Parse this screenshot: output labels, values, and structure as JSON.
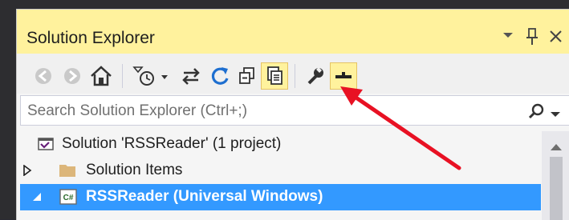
{
  "panel": {
    "title": "Solution Explorer",
    "title_controls": [
      "dropdown-arrow",
      "pin",
      "close"
    ]
  },
  "toolbar": {
    "buttons": [
      {
        "name": "back",
        "icon": "back-arrow-icon"
      },
      {
        "name": "forward",
        "icon": "forward-arrow-icon"
      },
      {
        "name": "home",
        "icon": "home-icon"
      },
      {
        "name": "pending-changes-filter",
        "icon": "clock-filter-icon"
      },
      {
        "name": "sync-with-active-document",
        "icon": "sync-icon"
      },
      {
        "name": "refresh",
        "icon": "refresh-icon"
      },
      {
        "name": "collapse-all",
        "icon": "collapse-all-icon"
      },
      {
        "name": "show-all-files",
        "icon": "show-all-files-icon",
        "highlighted": true
      },
      {
        "name": "properties",
        "icon": "wrench-icon"
      },
      {
        "name": "preview-selected-items",
        "icon": "preview-icon",
        "highlighted": true
      }
    ]
  },
  "search": {
    "placeholder": "Search Solution Explorer (Ctrl+;)"
  },
  "tree": {
    "items": [
      {
        "label": "Solution 'RSSReader' (1 project)",
        "icon": "solution-icon"
      },
      {
        "label": "Solution Items",
        "icon": "folder-icon",
        "expander": "collapsed"
      },
      {
        "label": "RSSReader (Universal Windows)",
        "icon": "csharp-project-icon",
        "expander": "expanded",
        "selected": true
      }
    ]
  },
  "colors": {
    "title_bar": "#fff29d",
    "selection": "#3399ff",
    "annotation_arrow": "#e81123",
    "highlight_border": "#e5c365"
  }
}
